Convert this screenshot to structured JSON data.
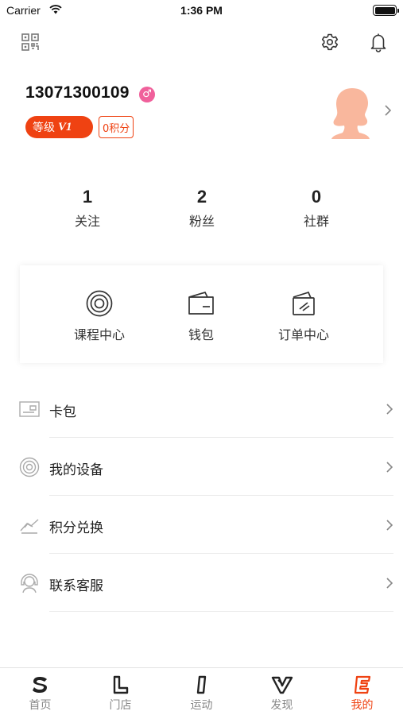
{
  "status_bar": {
    "carrier": "Carrier",
    "time": "1:36 PM"
  },
  "profile": {
    "username": "13071300109",
    "gender_symbol": "♂",
    "level_label": "等级",
    "level_value": "V1",
    "points_label": "0积分"
  },
  "stats": [
    {
      "value": "1",
      "label": "关注"
    },
    {
      "value": "2",
      "label": "粉丝"
    },
    {
      "value": "0",
      "label": "社群"
    }
  ],
  "services": [
    {
      "label": "课程中心",
      "icon": "target-icon"
    },
    {
      "label": "钱包",
      "icon": "wallet-icon"
    },
    {
      "label": "订单中心",
      "icon": "order-card-icon"
    }
  ],
  "menu": [
    {
      "label": "卡包",
      "icon": "card-icon"
    },
    {
      "label": "我的设备",
      "icon": "device-icon"
    },
    {
      "label": "积分兑换",
      "icon": "exchange-icon"
    },
    {
      "label": "联系客服",
      "icon": "customer-service-icon"
    }
  ],
  "tabs": [
    {
      "label": "首页",
      "icon": "home-s-icon",
      "active": false
    },
    {
      "label": "门店",
      "icon": "store-l-icon",
      "active": false
    },
    {
      "label": "运动",
      "icon": "sport-i-icon",
      "active": false
    },
    {
      "label": "发现",
      "icon": "discover-v-icon",
      "active": false
    },
    {
      "label": "我的",
      "icon": "mine-e-icon",
      "active": true
    }
  ],
  "colors": {
    "accent": "#ef4212",
    "avatar": "#f9b79d",
    "gender": "#f0609b"
  }
}
